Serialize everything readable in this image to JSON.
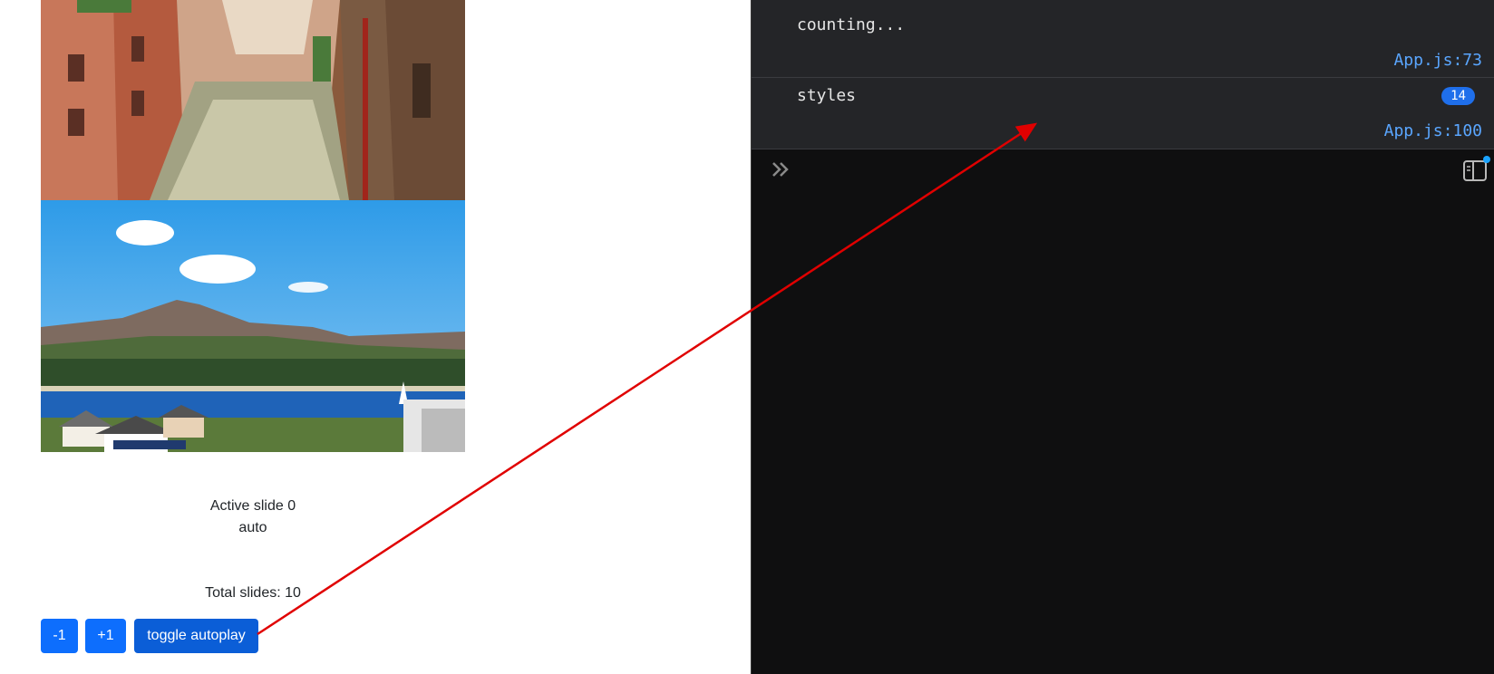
{
  "carousel": {
    "active_label": "Active slide 0",
    "mode": "auto",
    "total_label": "Total slides: 10",
    "slides": [
      {
        "name": "canal-street-photo"
      },
      {
        "name": "mountain-lake-photo"
      }
    ]
  },
  "controls": {
    "prev_label": "-1",
    "next_label": "+1",
    "toggle_label": "toggle autoplay"
  },
  "console": {
    "messages": [
      {
        "text": "counting...",
        "source": "App.js:73"
      },
      {
        "text": "styles",
        "count": "14",
        "source": "App.js:100"
      }
    ],
    "prompt_icon": "chevron-double-right-icon",
    "sidebar_icon": "sidebar-toggle-icon"
  },
  "annotation": {
    "color": "#e00000"
  }
}
